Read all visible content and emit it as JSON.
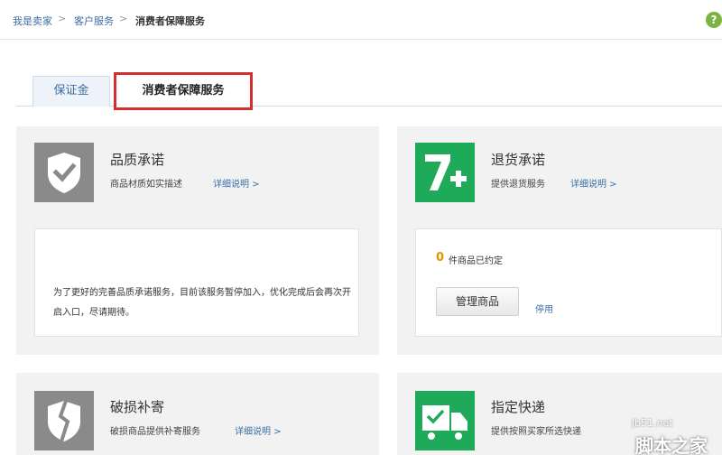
{
  "breadcrumb": {
    "items": [
      "我是卖家",
      "客户服务",
      "消费者保障服务"
    ],
    "separator": ">"
  },
  "help_glyph": "?",
  "tabs": [
    {
      "label": "保证金"
    },
    {
      "label": "消费者保障服务"
    }
  ],
  "cards": [
    {
      "title": "品质承诺",
      "description": "商品材质如实描述",
      "link": "详细说明 >",
      "icon": "shield-check-icon",
      "notice": "为了更好的完善品质承诺服务，目前该服务暂停加入，优化完成后会再次开启入口，尽请期待。"
    },
    {
      "title": "退货承诺",
      "description": "提供退货服务",
      "link": "详细说明 >",
      "icon": "seven-plus-icon",
      "count": "0",
      "count_label": "件商品已约定",
      "manage_button": "管理商品",
      "disable_link": "停用"
    },
    {
      "title": "破损补寄",
      "description": "破损商品提供补寄服务",
      "link": "详细说明 >",
      "icon": "broken-shield-icon"
    },
    {
      "title": "指定快递",
      "description": "提供按照买家所选快递",
      "icon": "delivery-truck-icon"
    }
  ],
  "colors": {
    "link": "#3a6ea5",
    "tab_highlight": "#d32f2f",
    "green_icon": "#1faa59",
    "gray_icon": "#8a8a8a",
    "count": "#e69500"
  },
  "watermark": {
    "site": "jb51.net",
    "brand": "脚本之家"
  }
}
